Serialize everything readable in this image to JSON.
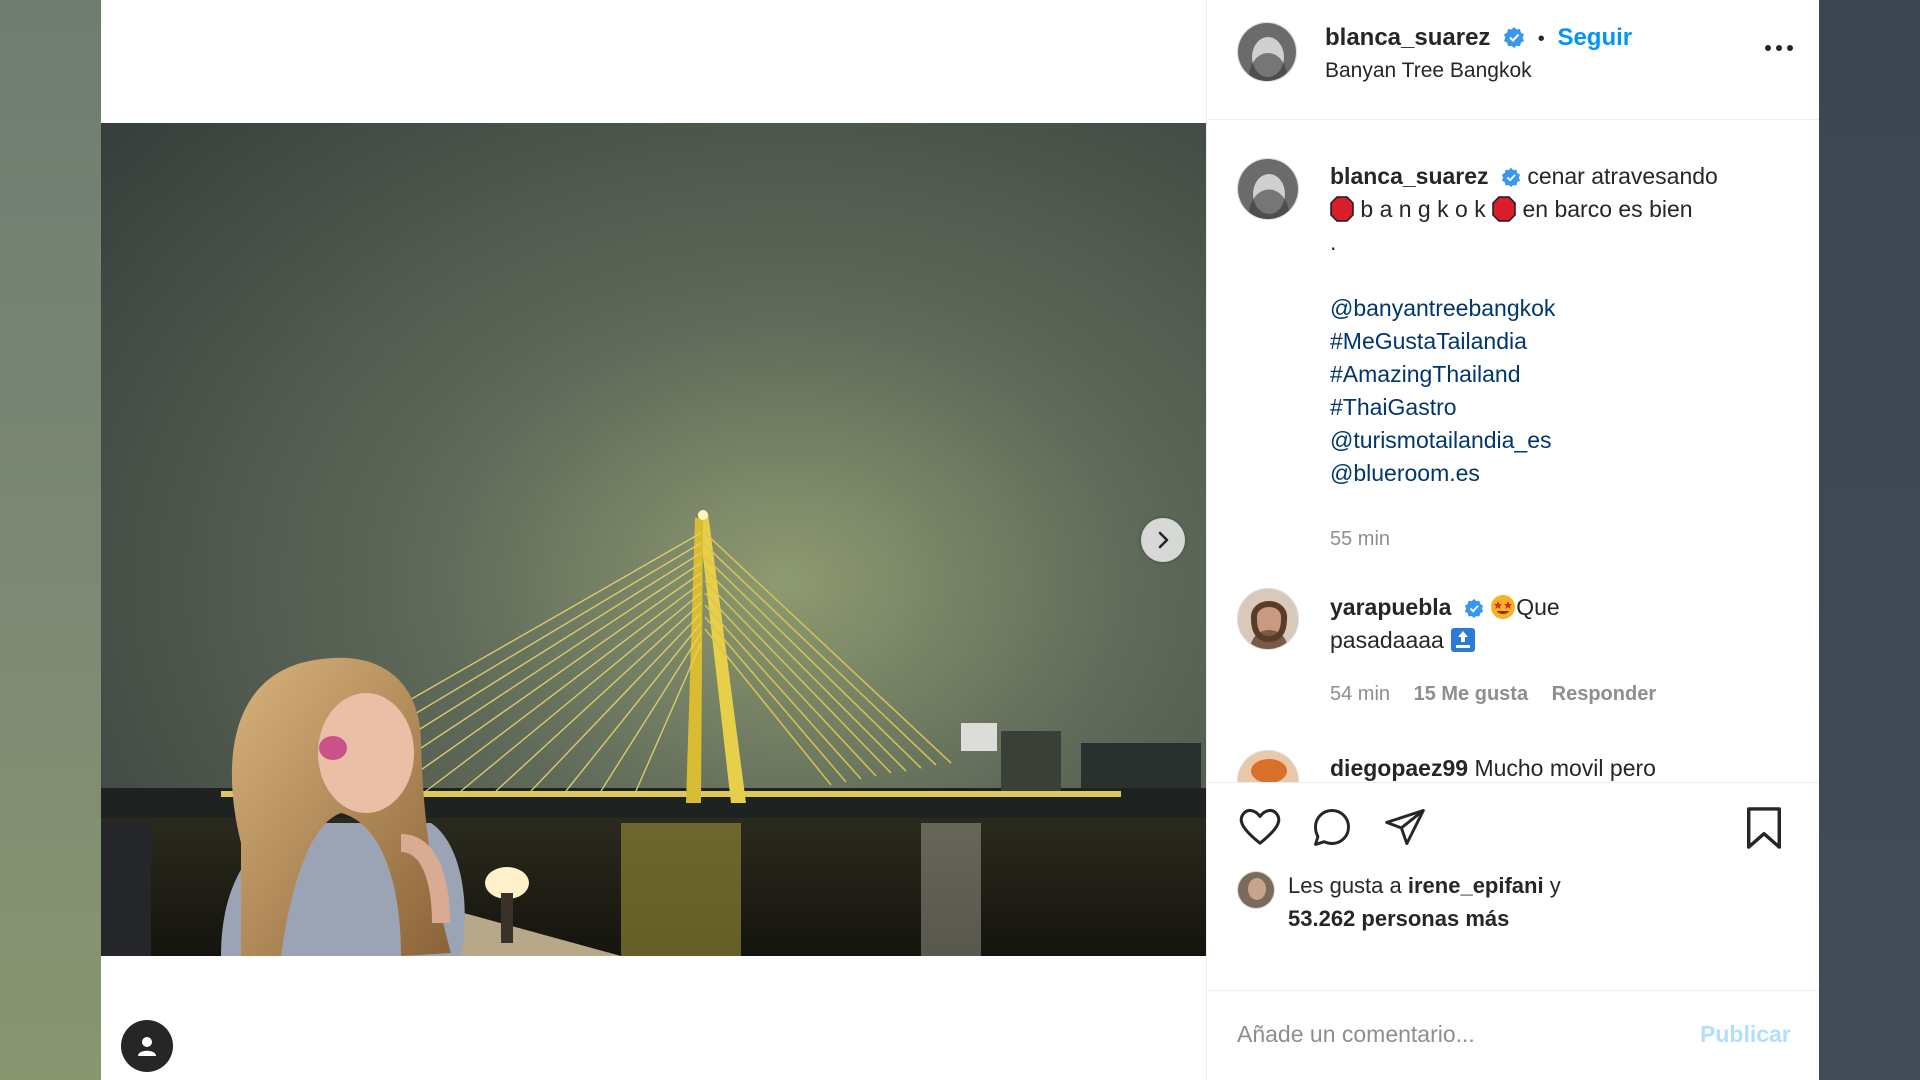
{
  "post": {
    "username": "blanca_suarez",
    "follow_label": "Seguir",
    "location": "Banyan Tree Bangkok",
    "caption": {
      "line1": "cenar atravesando",
      "line2_text": "b a n g k o k",
      "line2_tail": "en barco es bien",
      "line3": ".",
      "mention1": "@banyantreebangkok",
      "hashtag1": "#MeGustaTailandia",
      "hashtag2": "#AmazingThailand",
      "hashtag3": "#ThaiGastro",
      "mention2": "@turismotailandia_es",
      "mention3": "@blueroom.es",
      "time": "55 min"
    }
  },
  "comments": [
    {
      "username": "yarapuebla",
      "text_part1": "Que",
      "text_part2": "pasadaaaa",
      "time": "54 min",
      "likes": "15 Me gusta",
      "reply": "Responder"
    },
    {
      "username": "diegopaez99",
      "text": "Mucho movil pero"
    }
  ],
  "likes": {
    "prefix": "Les gusta a",
    "user": "irene_epifani",
    "conj": "y",
    "count_text": "53.262 personas más"
  },
  "add_comment": {
    "placeholder": "Añade un comentario...",
    "publish_label": "Publicar"
  },
  "colors": {
    "accent": "#0095f6",
    "link": "#00376b",
    "muted": "#8e8e8e"
  },
  "icons": [
    "verified-badge-icon",
    "more-options-icon",
    "chevron-right-icon",
    "user-tag-icon",
    "heart-icon",
    "comment-icon",
    "share-icon",
    "bookmark-icon",
    "small-heart-icon",
    "octagon-emoji",
    "star-eyes-emoji",
    "top-arrow-emoji"
  ]
}
